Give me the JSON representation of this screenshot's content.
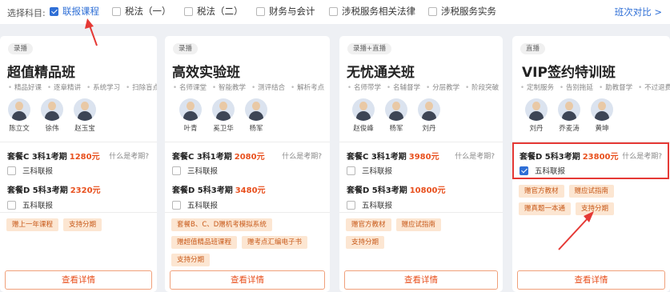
{
  "filter": {
    "label": "选择科目:",
    "subjects": [
      {
        "label": "联报课程",
        "checked": true
      },
      {
        "label": "税法（一）",
        "checked": false
      },
      {
        "label": "税法（二）",
        "checked": false
      },
      {
        "label": "财务与会计",
        "checked": false
      },
      {
        "label": "涉税服务相关法律",
        "checked": false
      },
      {
        "label": "涉税服务实务",
        "checked": false
      }
    ],
    "compare_link": "班次对比 >"
  },
  "cards": [
    {
      "tag": "录播",
      "title": "超值精品班",
      "features": [
        "精品好课",
        "逐章精讲",
        "系统学习",
        "扫除盲点"
      ],
      "teachers": [
        "陈立文",
        "徐伟",
        "赵玉宝"
      ],
      "packages": [
        {
          "name": "套餐C 3科1考期",
          "price": "1280元",
          "option": "三科联报",
          "checked": false,
          "what": "什么是考期?"
        },
        {
          "name": "套餐D 5科3考期",
          "price": "2320元",
          "option": "五科联报",
          "checked": false
        }
      ],
      "gifts": [
        "赠上一年课程",
        "支持分期"
      ],
      "detail": "查看详情"
    },
    {
      "tag": "录播",
      "title": "高效实验班",
      "features": [
        "名师课堂",
        "智能教学",
        "测评结合",
        "解析考点"
      ],
      "teachers": [
        "叶青",
        "奚卫华",
        "杨军"
      ],
      "packages": [
        {
          "name": "套餐C 3科1考期",
          "price": "2080元",
          "option": "三科联报",
          "checked": false,
          "what": "什么是考期?"
        },
        {
          "name": "套餐D 5科3考期",
          "price": "3480元",
          "option": "五科联报",
          "checked": false
        }
      ],
      "gifts": [
        "套餐B、C、D赠机考模拟系统",
        "赠超值精品班课程",
        "赠考点汇编电子书",
        "支持分期"
      ],
      "detail": "查看详情"
    },
    {
      "tag": "录播+直播",
      "title": "无忧通关班",
      "features": [
        "名师带学",
        "名辅督学",
        "分层教学",
        "阶段突破"
      ],
      "teachers": [
        "赵俊峰",
        "杨军",
        "刘丹"
      ],
      "packages": [
        {
          "name": "套餐C 3科1考期",
          "price": "3980元",
          "option": "三科联报",
          "checked": false,
          "what": "什么是考期?"
        },
        {
          "name": "套餐D 5科3考期",
          "price": "10800元",
          "option": "五科联报",
          "checked": false
        }
      ],
      "gifts": [
        "赠官方教材",
        "赠应试指南",
        "支持分期"
      ],
      "detail": "查看详情"
    },
    {
      "tag": "直播",
      "title": "VIP签约特训班",
      "features": [
        "定制服务",
        "告别拖延",
        "助教督学",
        "不过退费"
      ],
      "teachers": [
        "刘丹",
        "乔麦涛",
        "黄坤"
      ],
      "packages": [
        {
          "name": "套餐D 5科3考期",
          "price": "23800元",
          "option": "五科联报",
          "checked": true,
          "what": "什么是考期?"
        }
      ],
      "gifts": [
        "赠官方教材",
        "赠应试指南",
        "赠真题一本通",
        "支持分期"
      ],
      "detail": "查看详情"
    }
  ],
  "colors": {
    "accent_blue": "#2f6fd6",
    "price_orange": "#e8501e",
    "annotation_red": "#e53935"
  }
}
